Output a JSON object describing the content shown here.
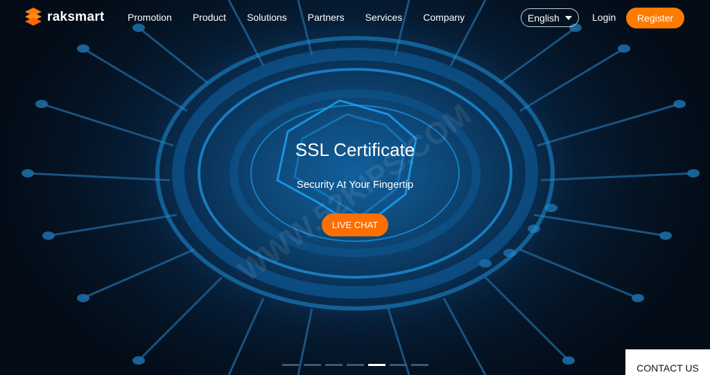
{
  "brand": {
    "name": "raksmart"
  },
  "nav": {
    "items": [
      {
        "label": "Promotion"
      },
      {
        "label": "Product"
      },
      {
        "label": "Solutions"
      },
      {
        "label": "Partners"
      },
      {
        "label": "Services"
      },
      {
        "label": "Company"
      }
    ]
  },
  "header": {
    "language": "English",
    "login": "Login",
    "register": "Register"
  },
  "hero": {
    "title": "SSL Certificate",
    "subtitle": "Security At Your Fingertip",
    "cta": "LIVE CHAT",
    "watermark": "WWW.52KIPS.COM"
  },
  "slider": {
    "count": 7,
    "active": 5
  },
  "footer": {
    "contact": "CONTACT US"
  },
  "colors": {
    "accent": "#ff7a00",
    "background": "#06121f",
    "ring": "#1b8fd8"
  },
  "icons": {
    "logo": "raksmart-logo-icon",
    "language_caret": "chevron-down-icon",
    "shield": "shield-icon"
  }
}
